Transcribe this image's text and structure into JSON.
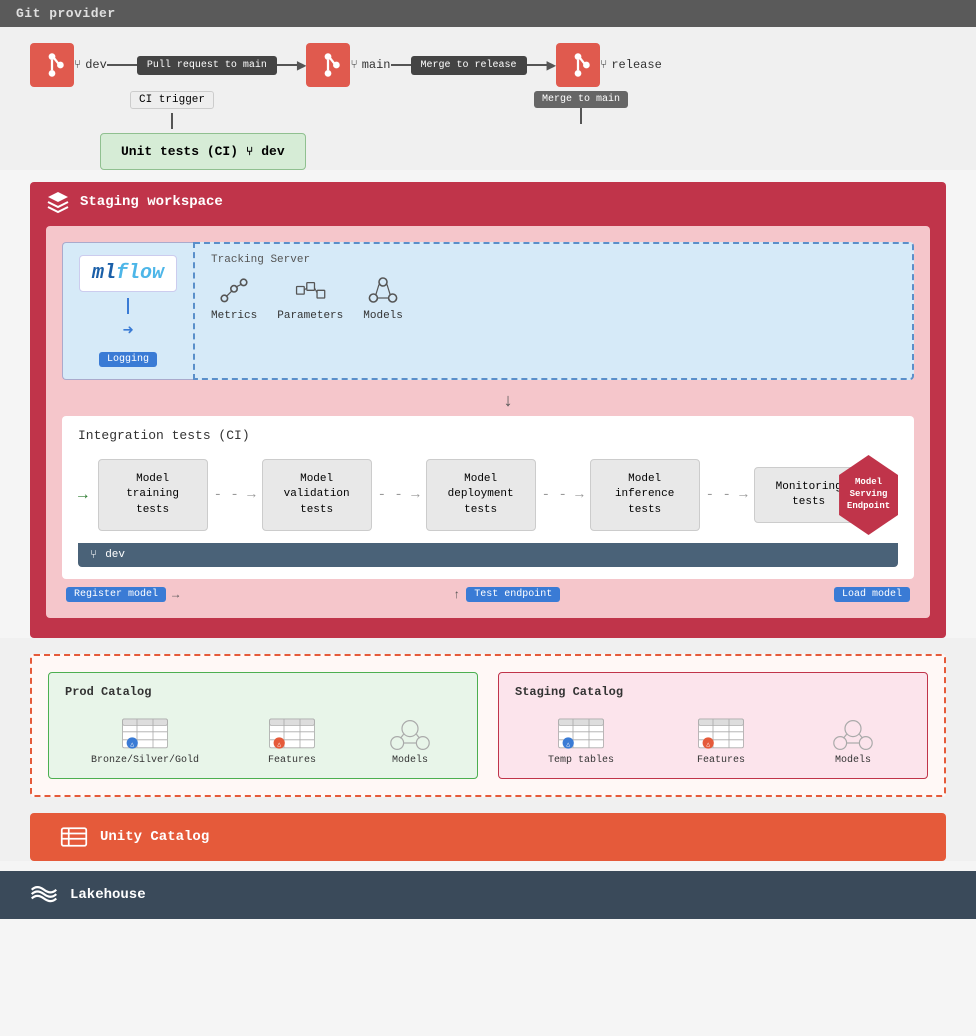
{
  "gitProviderBar": {
    "label": "Git provider"
  },
  "gitFlow": {
    "pullRequestLabel": "Pull request to main",
    "mergeToReleaseLabel": "Merge to release",
    "mergeToMainLabel": "Merge to main",
    "ciTriggerLabel": "CI trigger",
    "devBranch": "dev",
    "mainBranch": "main",
    "releaseBranch": "release"
  },
  "unitTests": {
    "label": "Unit tests (CI)",
    "branch": "dev"
  },
  "stagingWorkspace": {
    "label": "Staging workspace"
  },
  "mlflow": {
    "name": "mlflow",
    "loggingLabel": "Logging",
    "trackingServer": {
      "title": "Tracking Server",
      "metrics": "Metrics",
      "parameters": "Parameters",
      "models": "Models"
    }
  },
  "integrationTests": {
    "title": "Integration tests (CI)",
    "tests": [
      {
        "label": "Model training tests"
      },
      {
        "label": "Model validation tests"
      },
      {
        "label": "Model deployment tests"
      },
      {
        "label": "Model inference tests"
      },
      {
        "label": "Monitoring tests"
      }
    ],
    "devBranch": "dev"
  },
  "modelServingEndpoint": {
    "label": "Model Serving Endpoint"
  },
  "flowLabels": {
    "registerModel": "Register model",
    "testEndpoint": "Test endpoint",
    "loadModel": "Load model"
  },
  "prodCatalog": {
    "title": "Prod Catalog",
    "items": [
      {
        "label": "Bronze/Silver/Gold"
      },
      {
        "label": "Features"
      },
      {
        "label": "Models"
      }
    ]
  },
  "stagingCatalog": {
    "title": "Staging Catalog",
    "items": [
      {
        "label": "Temp tables"
      },
      {
        "label": "Features"
      },
      {
        "label": "Models"
      }
    ]
  },
  "unityCatalog": {
    "label": "Unity Catalog"
  },
  "lakehouse": {
    "label": "Lakehouse"
  },
  "colors": {
    "red": "#c0344a",
    "darkRed": "#a02030",
    "blue": "#3a7bd5",
    "darkGray": "#4a6278",
    "green": "#2e7d32",
    "lightGreen": "#d6ecd6",
    "orange": "#e55a3a"
  }
}
